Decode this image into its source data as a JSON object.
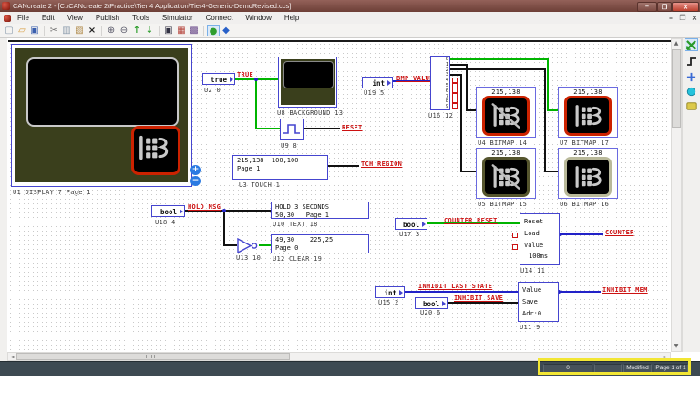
{
  "colors": {
    "titlebar": "#7c4a42",
    "accent_blue": "#4545cf",
    "wire_green": "#00b400",
    "wire_blue": "#2222c8",
    "wire_black": "#111111",
    "signal_red": "#cc1111",
    "bezel_olive": "#3a3f1c",
    "bitmap_border_red": "#cc2200",
    "statusbar": "#3d4a52",
    "highlight_yellow": "#f2e634"
  },
  "window": {
    "title": "CANcreate 2 - [C:\\CANcreate 2\\Practice\\Tier 4 Application\\Tier4-Generic-DemoRevised.ccs]",
    "minimize": "–",
    "restore": "❐",
    "close": "✕"
  },
  "menu": {
    "items": [
      "File",
      "Edit",
      "View",
      "Publish",
      "Tools",
      "Simulator",
      "Connect",
      "Window",
      "Help"
    ],
    "mdi_minimize": "–",
    "mdi_restore": "❐",
    "mdi_close": "×"
  },
  "toolbar": {
    "icons": [
      {
        "name": "new",
        "glyph": "▢"
      },
      {
        "name": "open",
        "glyph": "▱"
      },
      {
        "name": "save",
        "glyph": "▣"
      },
      {
        "name": "cut",
        "glyph": "✂"
      },
      {
        "name": "copy",
        "glyph": "▥"
      },
      {
        "name": "paste",
        "glyph": "▨"
      },
      {
        "name": "delete",
        "glyph": "×"
      },
      {
        "name": "zoom-in",
        "glyph": "⊕"
      },
      {
        "name": "zoom-out",
        "glyph": "⊖"
      },
      {
        "name": "page-up",
        "glyph": "↑"
      },
      {
        "name": "page-down",
        "glyph": "↓"
      },
      {
        "name": "display",
        "glyph": "▣"
      },
      {
        "name": "bitmap-grid",
        "glyph": "▦"
      },
      {
        "name": "pattern-grid",
        "glyph": "▩"
      },
      {
        "name": "simulate",
        "glyph": "●"
      },
      {
        "name": "connect",
        "glyph": "◆"
      }
    ]
  },
  "canvas": {
    "display": {
      "ref": "U1 DISPLAY 7 Page 1",
      "zoom_in": "+",
      "zoom_out": "−"
    },
    "u2": {
      "value": "true",
      "ref": "U2 0",
      "signal": "TRUE"
    },
    "u8": {
      "ref": "U8 BACKGROUND 13"
    },
    "u9": {
      "ref": "U9 8",
      "signal": "RESET"
    },
    "u19": {
      "value": "int",
      "ref": "U19 5",
      "signal": "BMP_VALUE"
    },
    "u16": {
      "ref": "U16 12",
      "pins": [
        "0",
        "1",
        "2",
        "3",
        "4",
        "5",
        "6",
        "7",
        "8",
        "9"
      ]
    },
    "u3": {
      "line1": "215,138  100,100",
      "line2": "Page 1",
      "ref": "U3 TOUCH 1",
      "signal": "TCH_REGION"
    },
    "u4": {
      "size": "215,138",
      "ref": "U4 BITMAP 14"
    },
    "u5": {
      "size": "215,138",
      "ref": "U5 BITMAP 15"
    },
    "u6": {
      "size": "215,138",
      "ref": "U6 BITMAP 16"
    },
    "u7": {
      "size": "215,138",
      "ref": "U7 BITMAP 17"
    },
    "u18": {
      "value": "bool",
      "ref": "U18 4",
      "signal": "HOLD_MSG"
    },
    "u10": {
      "line1": "HOLD 3 SECONDS",
      "line2": "50,30   Page 1",
      "ref": "U10 TEXT 18"
    },
    "u13": {
      "ref": "U13 10"
    },
    "u12": {
      "line1": "49,30    225,25",
      "line2": "Page 0",
      "ref": "U12 CLEAR 19"
    },
    "u17": {
      "value": "bool",
      "ref": "U17 3",
      "signal": "COUNTER_RESET"
    },
    "u14": {
      "in1": "Reset",
      "in2": "Load",
      "in3": "Value",
      "time": "100ms",
      "ref": "U14 11",
      "signal": "COUNTER"
    },
    "u15": {
      "value": "int",
      "ref": "U15 2",
      "signal": "INHIBIT_LAST_STATE"
    },
    "u20": {
      "value": "bool",
      "ref": "U20 6",
      "signal": "INHIBIT_SAVE"
    },
    "u11": {
      "in1": "Value",
      "in2": "Save",
      "adr": "Adr:0",
      "ref": "U11 9",
      "signal": "INHIBIT_MEM"
    }
  },
  "statusbar": {
    "cells": [
      "0",
      "",
      "Modified",
      "Page 1 of 1"
    ]
  }
}
